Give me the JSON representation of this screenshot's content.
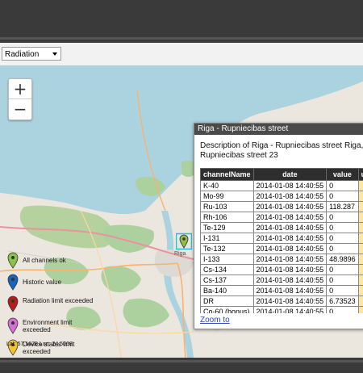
{
  "layer_select": {
    "value": "Radiation"
  },
  "map": {
    "zoom_in": "+",
    "zoom_out": "−",
    "place_label": "Riga",
    "coords": "Lat: 57.1628 Lon: 24.5008"
  },
  "legend": [
    {
      "label": "All channels ok",
      "color": "#8bc34a"
    },
    {
      "label": "Historic value",
      "color": "#1565c0"
    },
    {
      "label": "Radiation limit exceeded",
      "color": "#b71c1c"
    },
    {
      "label": "Environment limit exceeded",
      "color": "#d56fd6"
    },
    {
      "label": "Device status limit exceeded",
      "color": "#f4c430"
    }
  ],
  "popup": {
    "title": "Riga - Rupniecibas street",
    "description": "Description of Riga - Rupniecibas street Riga, Rupniecibas street 23",
    "columns": [
      "channelName",
      "date",
      "value",
      "u"
    ],
    "rows": [
      [
        "K-40",
        "2014-01-08 14:40:55",
        "0"
      ],
      [
        "Mo-99",
        "2014-01-08 14:40:55",
        "0"
      ],
      [
        "Ru-103",
        "2014-01-08 14:40:55",
        "118.287"
      ],
      [
        "Rh-106",
        "2014-01-08 14:40:55",
        "0"
      ],
      [
        "Te-129",
        "2014-01-08 14:40:55",
        "0"
      ],
      [
        "I-131",
        "2014-01-08 14:40:55",
        "0"
      ],
      [
        "Te-132",
        "2014-01-08 14:40:55",
        "0"
      ],
      [
        "I-133",
        "2014-01-08 14:40:55",
        "48.9896"
      ],
      [
        "Cs-134",
        "2014-01-08 14:40:55",
        "0"
      ],
      [
        "Cs-137",
        "2014-01-08 14:40:55",
        "0"
      ],
      [
        "Ba-140",
        "2014-01-08 14:40:55",
        "0"
      ],
      [
        "DR",
        "2014-01-08 14:40:55",
        "6.73523"
      ],
      [
        "Co-60 (bonus)",
        "2014-01-08 14:40:55",
        "0"
      ]
    ],
    "zoom_link": "Zoom to"
  }
}
